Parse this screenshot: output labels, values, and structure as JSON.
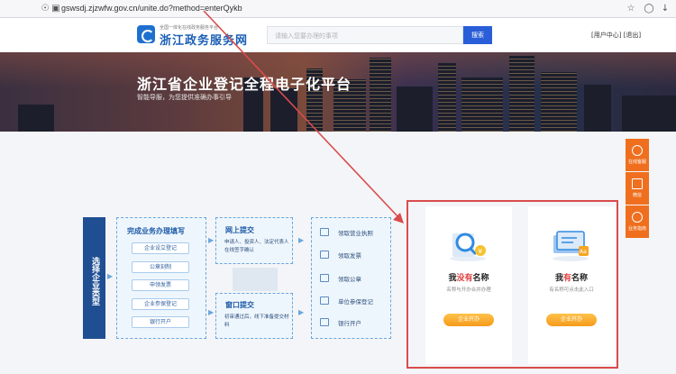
{
  "browser": {
    "url": "gswsdj.zjzwfw.gov.cn/unite.do?method=enterQykb"
  },
  "header": {
    "logo_sub": "全国一体化在线政务服务平台",
    "logo_title": "浙江政务服务网",
    "search_placeholder": "请输入您要办理的事项",
    "search_button": "搜索",
    "user_center": "[用户中心]",
    "logout": "[退出]"
  },
  "banner": {
    "title": "浙江省企业登记全程电子化平台",
    "subtitle": "智能导服，为您提供准确办事引导"
  },
  "flow": {
    "side_label": "选择企业类型",
    "step1": {
      "title": "完成业务办理填写",
      "items": [
        "企业设立登记",
        "公章刻制",
        "申领发票",
        "企业参保登记",
        "银行开户"
      ]
    },
    "step2": {
      "title": "网上提交",
      "desc": "申请人、投资人、法定代表人在线签字确认"
    },
    "step3": {
      "title": "窗口提交",
      "desc": "初审通过后，线下准备提交材料"
    },
    "results": [
      "领取营业执照",
      "领取发票",
      "领取公章",
      "单位参保登记",
      "银行开户"
    ]
  },
  "cards": [
    {
      "title_pre": "我",
      "title_red": "没有",
      "title_post": "名称",
      "desc": "名称与开办合并办理",
      "button": "企业开办"
    },
    {
      "title_pre": "我",
      "title_red": "有",
      "title_post": "名称",
      "desc": "有名称可点击此入口",
      "button": "企业开办"
    }
  ],
  "floatbar": [
    {
      "label": "在线客服",
      "icon": "chat-icon"
    },
    {
      "label": "微信",
      "icon": "qrcode-icon"
    },
    {
      "label": "业务指南",
      "icon": "compass-icon"
    }
  ],
  "colors": {
    "brand_blue": "#1f4e93",
    "accent_orange": "#f59a1a",
    "annotation_red": "#d94c4c"
  }
}
